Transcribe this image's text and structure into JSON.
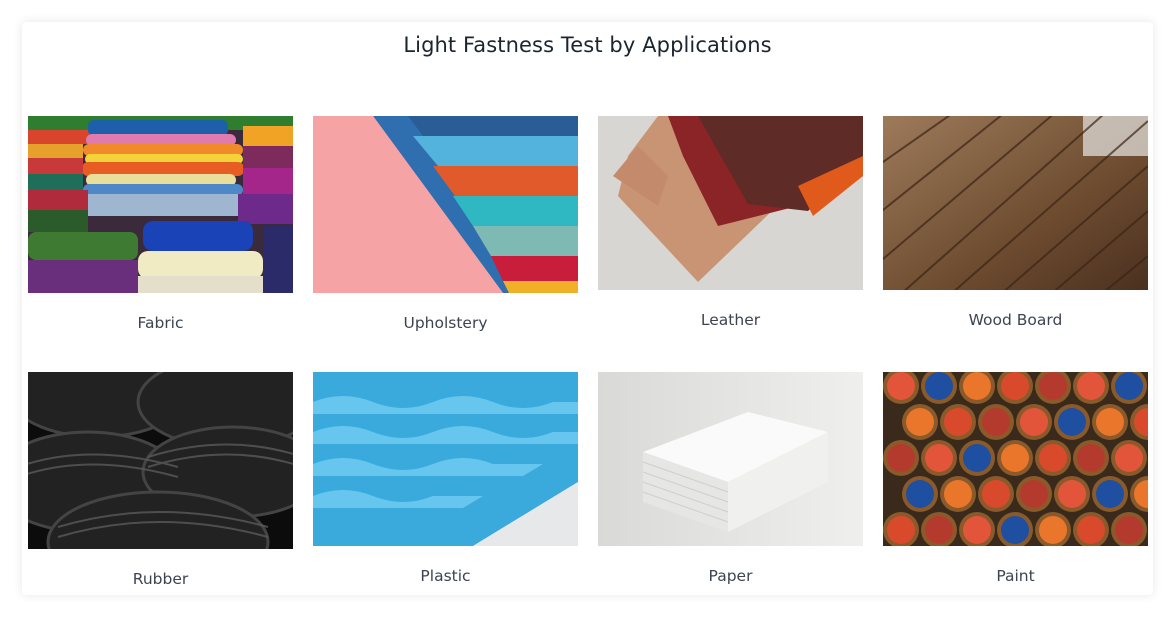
{
  "page": {
    "title": "Light Fastness Test by Applications"
  },
  "applications": [
    {
      "label": "Fabric",
      "image": "fabric-image"
    },
    {
      "label": "Upholstery",
      "image": "upholstery-image"
    },
    {
      "label": "Leather",
      "image": "leather-image"
    },
    {
      "label": "Wood Board",
      "image": "wood-board-image"
    },
    {
      "label": "Rubber",
      "image": "rubber-image"
    },
    {
      "label": "Plastic",
      "image": "plastic-image"
    },
    {
      "label": "Paper",
      "image": "paper-image"
    },
    {
      "label": "Paint",
      "image": "paint-image"
    }
  ]
}
